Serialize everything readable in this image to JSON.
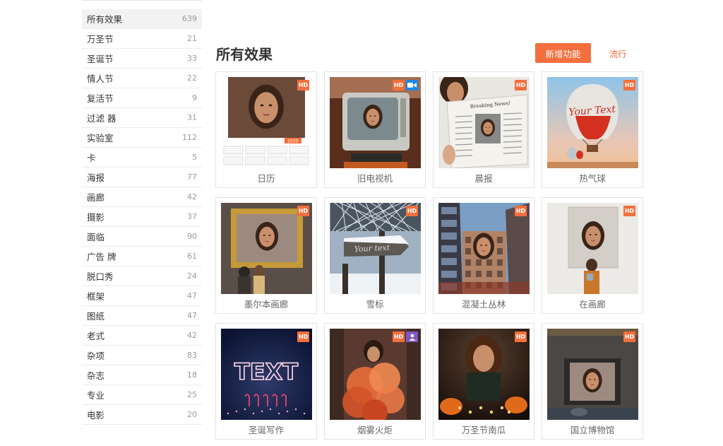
{
  "sidebar": {
    "categories": [
      {
        "label": "所有效果",
        "count": "639",
        "active": true
      },
      {
        "label": "万圣节",
        "count": "21"
      },
      {
        "label": "圣诞节",
        "count": "33"
      },
      {
        "label": "情人节",
        "count": "22"
      },
      {
        "label": "复活节",
        "count": "9"
      },
      {
        "label": "过滤 器",
        "count": "31"
      },
      {
        "label": "实验室",
        "count": "112"
      },
      {
        "label": "卡",
        "count": "5"
      },
      {
        "label": "海报",
        "count": "77"
      },
      {
        "label": "画廊",
        "count": "42"
      },
      {
        "label": "摄影",
        "count": "37"
      },
      {
        "label": "面临",
        "count": "90"
      },
      {
        "label": "广告 牌",
        "count": "61"
      },
      {
        "label": "脱口秀",
        "count": "24"
      },
      {
        "label": "框架",
        "count": "47"
      },
      {
        "label": "图纸",
        "count": "47"
      },
      {
        "label": "老式",
        "count": "42"
      },
      {
        "label": "杂项",
        "count": "83"
      },
      {
        "label": "杂志",
        "count": "18"
      },
      {
        "label": "专业",
        "count": "25"
      },
      {
        "label": "电影",
        "count": "20"
      }
    ]
  },
  "header": {
    "title": "所有效果",
    "new_features_label": "新增功能",
    "popular_label": "流行"
  },
  "badges": {
    "hd": "HD"
  },
  "effects": [
    {
      "label": "日历",
      "hd": true,
      "thumb": "calendar",
      "calendar_year": "2025"
    },
    {
      "label": "旧电视机",
      "hd": true,
      "extra": "video-camera-icon",
      "thumb": "tv"
    },
    {
      "label": "晨报",
      "hd": true,
      "thumb": "newspaper",
      "headline": "Breaking News!"
    },
    {
      "label": "热气球",
      "hd": true,
      "thumb": "balloon",
      "balloon_text": "Your Text"
    },
    {
      "label": "墨尔本画廊",
      "hd": true,
      "thumb": "gallery-frame"
    },
    {
      "label": "雪标",
      "hd": true,
      "thumb": "snow-sign",
      "sign_text": "Your text"
    },
    {
      "label": "混凝土丛林",
      "hd": true,
      "thumb": "city"
    },
    {
      "label": "在画廊",
      "hd": true,
      "thumb": "gallery-white"
    },
    {
      "label": "圣诞写作",
      "hd": true,
      "thumb": "neon-text",
      "neon_text": "TEXT"
    },
    {
      "label": "烟雾火炬",
      "hd": true,
      "extra": "user-icon",
      "thumb": "smoke"
    },
    {
      "label": "万圣节南瓜",
      "hd": true,
      "thumb": "pumpkins"
    },
    {
      "label": "国立博物馆",
      "hd": true,
      "thumb": "museum"
    }
  ],
  "colors": {
    "accent": "#f36f3d",
    "video_badge": "#1e88e5",
    "user_badge": "#7e57c2"
  }
}
